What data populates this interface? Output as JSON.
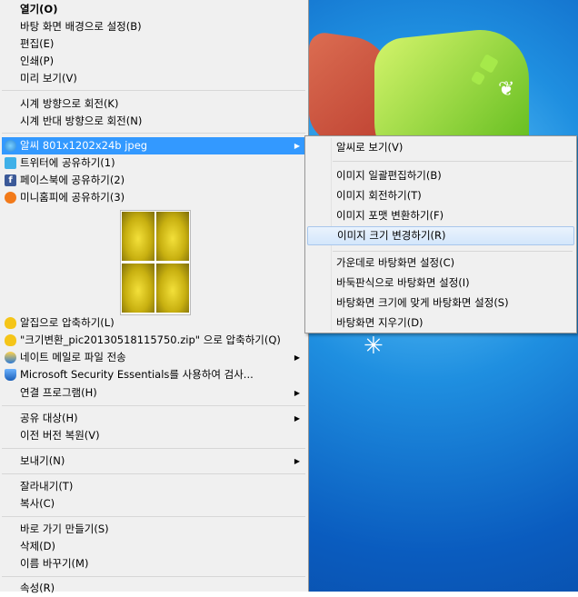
{
  "menu": {
    "items": [
      {
        "label": "열기(O)",
        "bold": true
      },
      {
        "label": "바탕 화면 배경으로 설정(B)"
      },
      {
        "label": "편집(E)"
      },
      {
        "label": "인쇄(P)"
      },
      {
        "label": "미리 보기(V)"
      },
      {
        "label": "시계 방향으로 회전(K)"
      },
      {
        "label": "시계 반대 방향으로 회전(N)"
      },
      {
        "label": "알씨 801x1202x24b jpeg",
        "icon": "alsee-icon",
        "submenu": true
      },
      {
        "label": "트위터에 공유하기(1)",
        "icon": "twitter-icon"
      },
      {
        "label": "페이스북에 공유하기(2)",
        "icon": "facebook-icon"
      },
      {
        "label": "미니홈피에 공유하기(3)",
        "icon": "minihompy-icon"
      },
      {
        "label": "알집으로 압축하기(L)",
        "icon": "alzip-icon"
      },
      {
        "label": "\"크기변환_pic20130518115750.zip\" 으로 압축하기(Q)",
        "icon": "alzip-icon"
      },
      {
        "label": "네이트 메일로 파일 전송",
        "icon": "nate-mail-icon",
        "submenu": true
      },
      {
        "label": "Microsoft Security Essentials를 사용하여 검사...",
        "icon": "security-essentials-icon"
      },
      {
        "label": "연결 프로그램(H)",
        "submenu": true
      },
      {
        "label": "공유 대상(H)",
        "submenu": true
      },
      {
        "label": "이전 버전 복원(V)"
      },
      {
        "label": "보내기(N)",
        "submenu": true
      },
      {
        "label": "잘라내기(T)"
      },
      {
        "label": "복사(C)"
      },
      {
        "label": "바로 가기 만들기(S)"
      },
      {
        "label": "삭제(D)"
      },
      {
        "label": "이름 바꾸기(M)"
      },
      {
        "label": "속성(R)"
      }
    ]
  },
  "submenu": {
    "items": [
      {
        "label": "알씨로 보기(V)"
      },
      {
        "label": "이미지 일괄편집하기(B)"
      },
      {
        "label": "이미지 회전하기(T)"
      },
      {
        "label": "이미지 포맷 변환하기(F)"
      },
      {
        "label": "이미지 크기 변경하기(R)"
      },
      {
        "label": "가운데로 바탕화면 설정(C)"
      },
      {
        "label": "바둑판식으로 바탕화면 설정(I)"
      },
      {
        "label": "바탕화면 크기에 맞게 바탕화면 설정(S)"
      },
      {
        "label": "바탕화면 지우기(D)"
      }
    ]
  },
  "colors": {
    "menu_bg": "#f0f0f0",
    "highlight": "#3399ff",
    "hover": "#c1dcfc"
  }
}
